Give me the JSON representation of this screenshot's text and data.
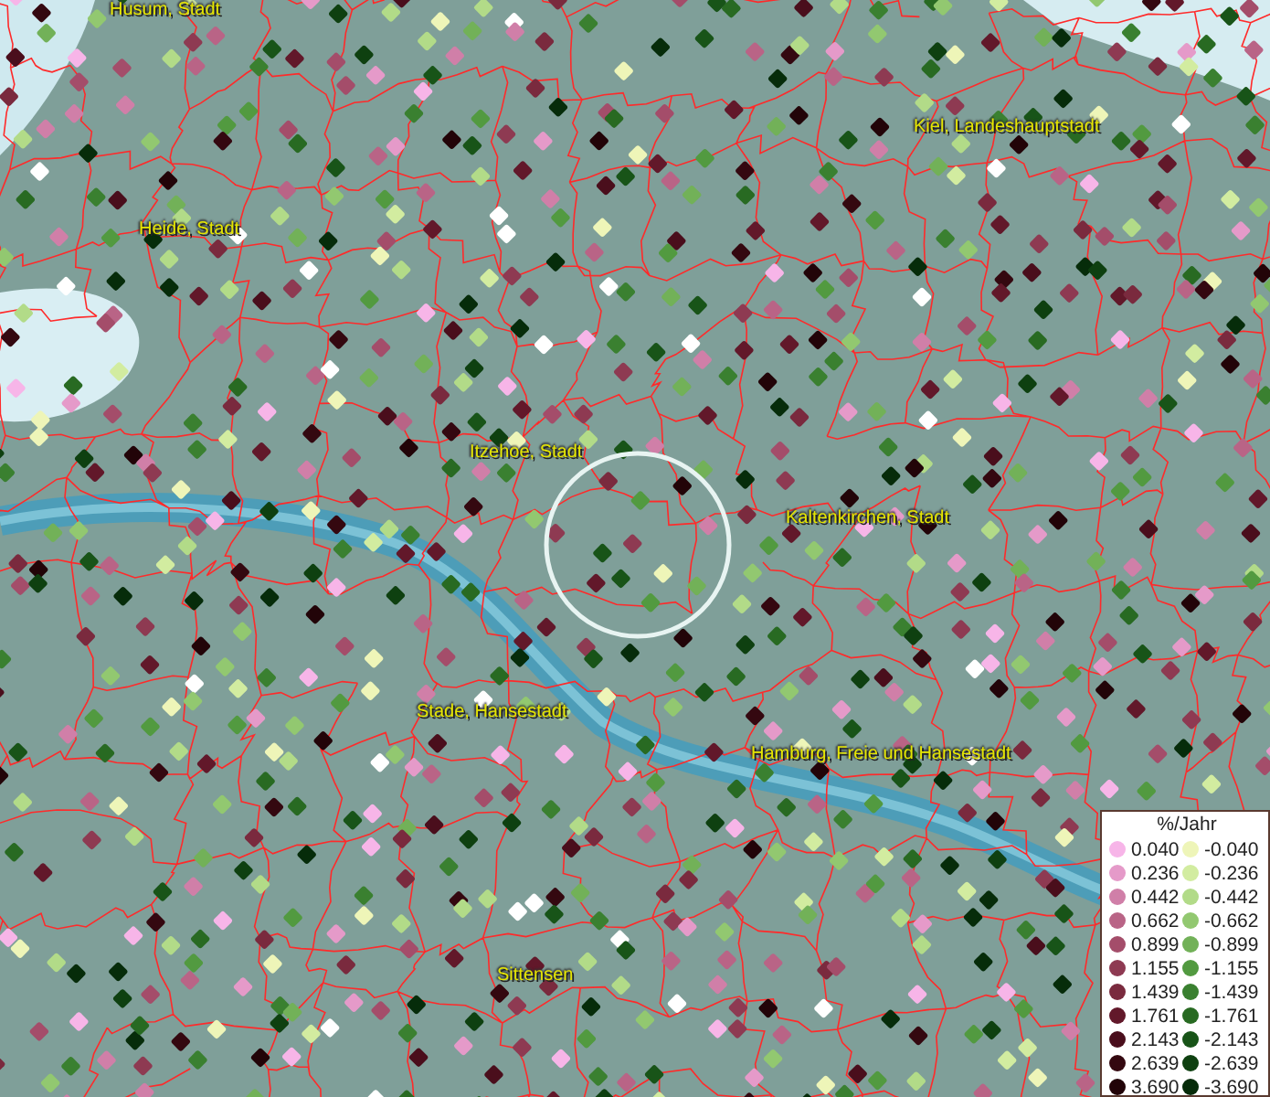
{
  "map": {
    "place_labels": [
      "Husum, Stadt",
      "Kiel, Landeshauptstadt",
      "Heide, Stadt",
      "Itzehoe, Stadt",
      "Kaltenkirchen, Stadt",
      "Stade, Hansestadt",
      "Hamburg, Freie und Hansestadt",
      "Sittensen"
    ]
  },
  "legend": {
    "title": "%/Jahr",
    "rows": [
      {
        "positive": {
          "value": "0.040",
          "color": "#f7b5e8"
        },
        "negative": {
          "value": "-0.040",
          "color": "#eef5b8"
        }
      },
      {
        "positive": {
          "value": "0.236",
          "color": "#e59ac9"
        },
        "negative": {
          "value": "-0.236",
          "color": "#d2eca0"
        }
      },
      {
        "positive": {
          "value": "0.442",
          "color": "#d07fa8"
        },
        "negative": {
          "value": "-0.442",
          "color": "#b2db88"
        }
      },
      {
        "positive": {
          "value": "0.662",
          "color": "#b96486"
        },
        "negative": {
          "value": "-0.662",
          "color": "#92c870"
        }
      },
      {
        "positive": {
          "value": "0.899",
          "color": "#a44d6a"
        },
        "negative": {
          "value": "-0.899",
          "color": "#72b158"
        }
      },
      {
        "positive": {
          "value": "1.155",
          "color": "#8e3a52"
        },
        "negative": {
          "value": "-1.155",
          "color": "#529a40"
        }
      },
      {
        "positive": {
          "value": "1.439",
          "color": "#7a2a3e"
        },
        "negative": {
          "value": "-1.439",
          "color": "#3a8030"
        }
      },
      {
        "positive": {
          "value": "1.761",
          "color": "#62182a"
        },
        "negative": {
          "value": "-1.761",
          "color": "#286a22"
        }
      },
      {
        "positive": {
          "value": "2.143",
          "color": "#4a0e1c"
        },
        "negative": {
          "value": "-2.143",
          "color": "#185418"
        }
      },
      {
        "positive": {
          "value": "2.639",
          "color": "#340810"
        },
        "negative": {
          "value": "-2.639",
          "color": "#0e4010"
        }
      },
      {
        "positive": {
          "value": "3.690",
          "color": "#220408"
        },
        "negative": {
          "value": "-3.690",
          "color": "#062c0a"
        }
      }
    ]
  }
}
